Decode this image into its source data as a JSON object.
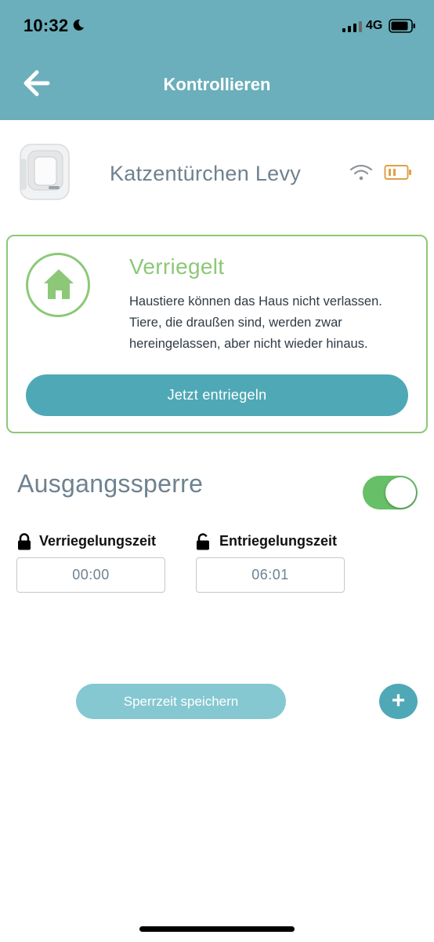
{
  "status_bar": {
    "time": "10:32",
    "network": "4G"
  },
  "header": {
    "title": "Kontrollieren",
    "back_icon": "arrow-left-icon"
  },
  "device": {
    "name": "Katzentürchen Levy",
    "wifi_icon": "wifi-icon",
    "battery_icon": "battery-low-icon",
    "battery_color": "#e0a04a"
  },
  "status_card": {
    "title": "Verriegelt",
    "description_lines": [
      "Haustiere können das Haus nicht verlassen.",
      "Tiere, die draußen sind, werden zwar",
      "hereingelassen, aber nicht wieder hinaus."
    ],
    "button_label": "Jetzt entriegeln",
    "accent_color": "#8cc878",
    "icon": "home-icon"
  },
  "curfew": {
    "title": "Ausgangssperre",
    "enabled": true,
    "lock_time_label": "Verriegelungszeit",
    "lock_time_value": "00:00",
    "unlock_time_label": "Entriegelungszeit",
    "unlock_time_value": "06:01",
    "save_label": "Sperrzeit speichern",
    "add_label": "+"
  },
  "colors": {
    "header": "#6aafbb",
    "primary": "#4fa8b6",
    "toggle_on": "#67bf67"
  }
}
